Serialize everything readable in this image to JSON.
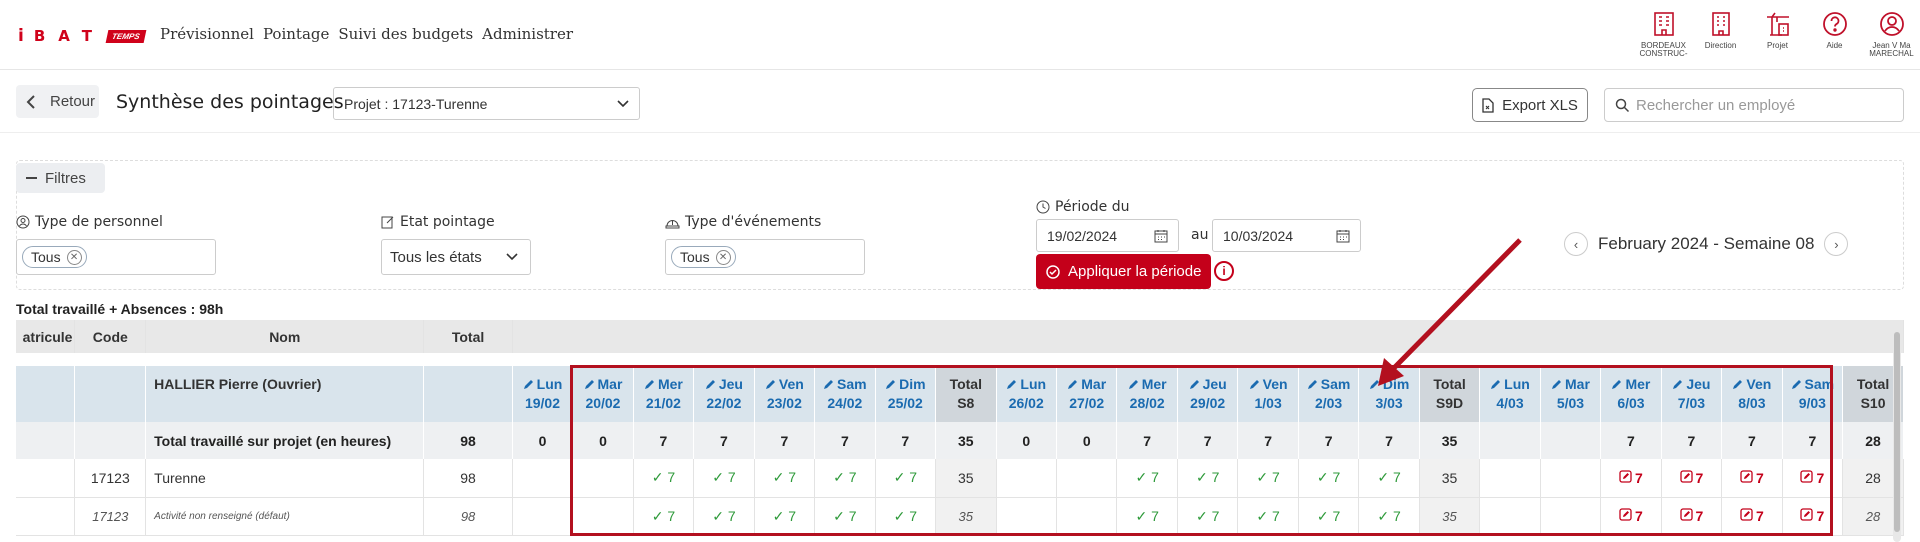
{
  "brand": {
    "letter": "i",
    "word": "BAT",
    "badge": "TEMPS"
  },
  "nav": [
    "Prévisionnel",
    "Pointage",
    "Suivi des budgets",
    "Administrer"
  ],
  "top_icons": [
    {
      "name": "building-icon",
      "label": "BORDEAUX CONSTRUC-"
    },
    {
      "name": "building-icon",
      "label": "Direction"
    },
    {
      "name": "crane-icon",
      "label": "Projet"
    },
    {
      "name": "help-icon",
      "label": "Aide"
    },
    {
      "name": "user-icon",
      "label": "Jean V Ma MARECHAL"
    }
  ],
  "subbar": {
    "back_label": "Retour",
    "title": "Synthèse des pointages",
    "project_select": "Projet : 17123-Turenne",
    "export_label": "Export XLS",
    "search_placeholder": "Rechercher un employé"
  },
  "filters": {
    "toggle_label": "Filtres",
    "type_personnel_label": "Type de personnel",
    "type_personnel_chip": "Tous",
    "etat_label": "Etat pointage",
    "etat_value": "Tous les états",
    "evenements_label": "Type d'événements",
    "evenements_chip": "Tous",
    "periode_label": "Période du",
    "date_from": "19/02/2024",
    "au_label": "au",
    "date_to": "10/03/2024",
    "apply_label": "Appliquer la période",
    "week_label": "February 2024 - Semaine 08"
  },
  "summary": "Total travaillé + Absences : 98h",
  "table": {
    "columns": [
      "atricule",
      "Code",
      "Nom",
      "Total"
    ],
    "employee": "HALLIER Pierre (Ouvrier)",
    "days": [
      [
        "Lun",
        "19/02"
      ],
      [
        "Mar",
        "20/02"
      ],
      [
        "Mer",
        "21/02"
      ],
      [
        "Jeu",
        "22/02"
      ],
      [
        "Ven",
        "23/02"
      ],
      [
        "Sam",
        "24/02"
      ],
      [
        "Dim",
        "25/02"
      ],
      [
        "Total",
        "S8"
      ],
      [
        "Lun",
        "26/02"
      ],
      [
        "Mar",
        "27/02"
      ],
      [
        "Mer",
        "28/02"
      ],
      [
        "Jeu",
        "29/02"
      ],
      [
        "Ven",
        "1/03"
      ],
      [
        "Sam",
        "2/03"
      ],
      [
        "Dim",
        "3/03"
      ],
      [
        "Total",
        "S9D"
      ],
      [
        "Lun",
        "4/03"
      ],
      [
        "Mar",
        "5/03"
      ],
      [
        "Mer",
        "6/03"
      ],
      [
        "Jeu",
        "7/03"
      ],
      [
        "Ven",
        "8/03"
      ],
      [
        "Sam",
        "9/03"
      ],
      [
        "Total",
        "S10"
      ]
    ],
    "total_row": {
      "label": "Total travaillé sur projet (en heures)",
      "total": "98",
      "values": [
        "0",
        "0",
        "7",
        "7",
        "7",
        "7",
        "7",
        "35",
        "0",
        "0",
        "7",
        "7",
        "7",
        "7",
        "7",
        "35",
        "",
        "",
        "7",
        "7",
        "7",
        "7",
        "28"
      ]
    },
    "rows": [
      {
        "code": "17123",
        "name": "Turenne",
        "total": "98",
        "values": [
          "",
          "",
          "ok:7",
          "ok:7",
          "ok:7",
          "ok:7",
          "ok:7",
          "35",
          "",
          "",
          "ok:7",
          "ok:7",
          "ok:7",
          "ok:7",
          "ok:7",
          "35",
          "",
          "",
          "edit:7",
          "edit:7",
          "edit:7",
          "edit:7",
          "28"
        ]
      },
      {
        "code": "17123",
        "name": "Activité non renseigné (défaut)",
        "total": "98",
        "values": [
          "",
          "",
          "ok:7",
          "ok:7",
          "ok:7",
          "ok:7",
          "ok:7",
          "35",
          "",
          "",
          "ok:7",
          "ok:7",
          "ok:7",
          "ok:7",
          "ok:7",
          "35",
          "",
          "",
          "edit:7",
          "edit:7",
          "edit:7",
          "edit:7",
          "28"
        ]
      }
    ]
  },
  "colors": {
    "accent": "#c4001a",
    "link": "#1b6bb0",
    "ok": "#2e9a3a"
  }
}
